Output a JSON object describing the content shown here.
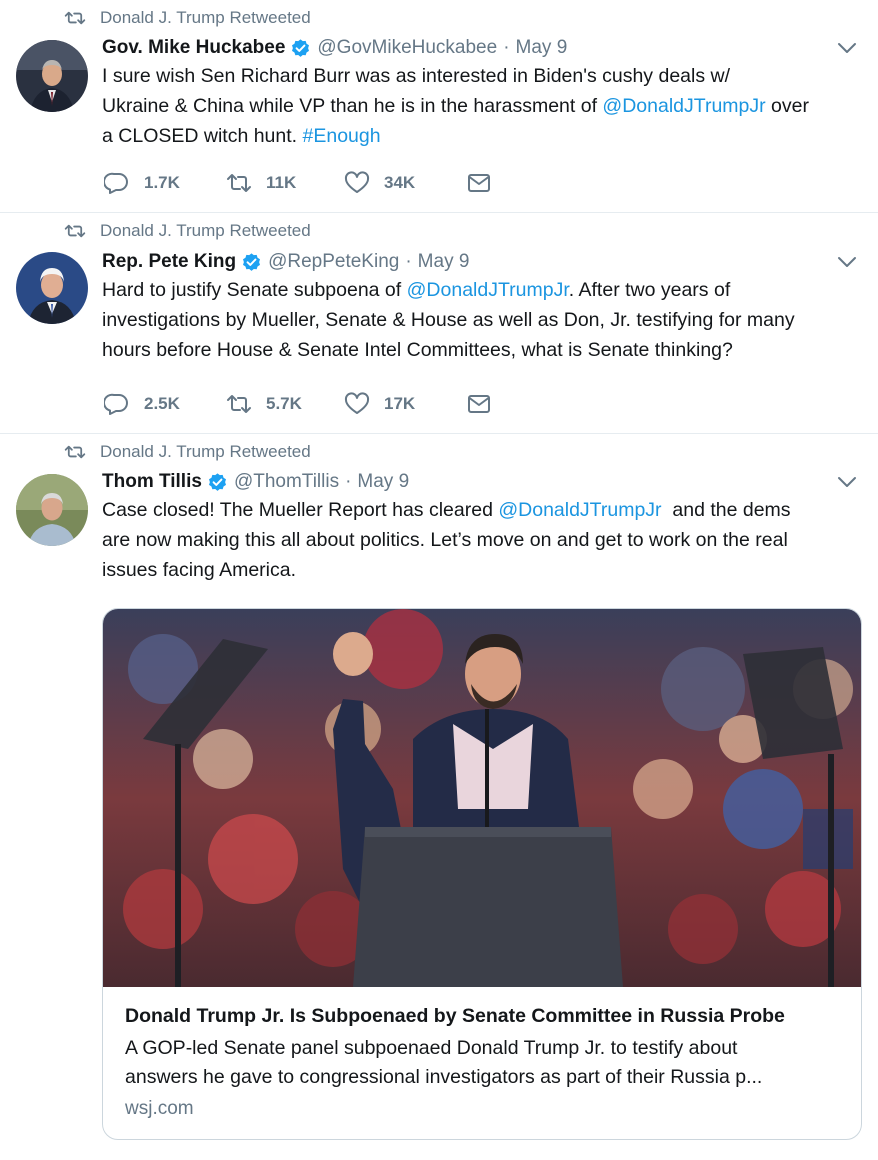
{
  "tweets": [
    {
      "retweeted_by": "Donald J. Trump Retweeted",
      "name": "Gov. Mike Huckabee",
      "handle": "@GovMikeHuckabee",
      "date": "May 9",
      "lines": [
        [
          "I sure wish Sen Richard Burr was as interested in Biden's cushy deals w/"
        ],
        [
          "Ukraine & China while VP than he is in the harassment of ",
          "@DonaldJTrumpJr",
          " over"
        ],
        [
          "a CLOSED witch hunt. ",
          "#Enough"
        ]
      ],
      "replies": "1.7K",
      "retweets": "11K",
      "likes": "34K"
    },
    {
      "retweeted_by": "Donald J. Trump Retweeted",
      "name": "Rep. Pete King",
      "handle": "@RepPeteKing",
      "date": "May 9",
      "lines": [
        [
          "Hard to justify Senate subpoena of ",
          "@DonaldJTrumpJr",
          ". After two years of"
        ],
        [
          "investigations by Mueller, Senate & House as well as Don, Jr. testifying for many"
        ],
        [
          "hours before House & Senate Intel Committees, what is Senate thinking?"
        ]
      ],
      "replies": "2.5K",
      "retweets": "5.7K",
      "likes": "17K"
    },
    {
      "retweeted_by": "Donald J. Trump Retweeted",
      "name": "Thom Tillis",
      "handle": "@ThomTillis",
      "date": "May 9",
      "lines": [
        [
          "Case closed! The Mueller Report has cleared ",
          "@DonaldJTrumpJr",
          "  and the dems"
        ],
        [
          "are now making this all about politics. Let’s move on and get to work on the real"
        ],
        [
          "issues facing America."
        ]
      ]
    }
  ],
  "card": {
    "title": "Donald Trump Jr. Is Subpoenaed by Senate Committee in Russia Probe",
    "desc_line1": "A GOP-led Senate panel subpoenaed Donald Trump Jr. to testify about",
    "desc_line2": "answers he gave to congressional investigators as part of their Russia p...",
    "domain": "wsj.com"
  },
  "colors": {
    "link": "#1b95e0",
    "verified": "#1da1f2",
    "muted": "#657786",
    "divider": "#e6ecf0"
  },
  "icons": [
    "retweet-icon",
    "verified-badge-icon",
    "chevron-down-icon",
    "reply-icon",
    "like-icon",
    "message-icon"
  ]
}
